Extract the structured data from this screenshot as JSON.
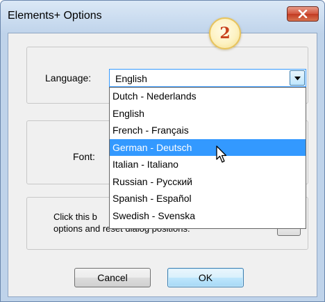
{
  "window": {
    "title": "Elements+ Options",
    "close_icon": "close-x-icon",
    "close_color": "#c8422a"
  },
  "badge": {
    "text": "2"
  },
  "language": {
    "label": "Language:",
    "value": "English",
    "options": [
      "Dutch - Nederlands",
      "English",
      "French - Français",
      "German - Deutsch",
      "Italian - Italiano",
      "Russian - Русский",
      "Spanish - Español",
      "Swedish - Svenska"
    ],
    "highlighted": "German - Deutsch",
    "highlight_color": "#3399ff"
  },
  "font": {
    "label": "Font:"
  },
  "reset": {
    "line1": "Click this b",
    "line2": "options and reset dialog positions."
  },
  "buttons": {
    "cancel": "Cancel",
    "ok": "OK"
  }
}
